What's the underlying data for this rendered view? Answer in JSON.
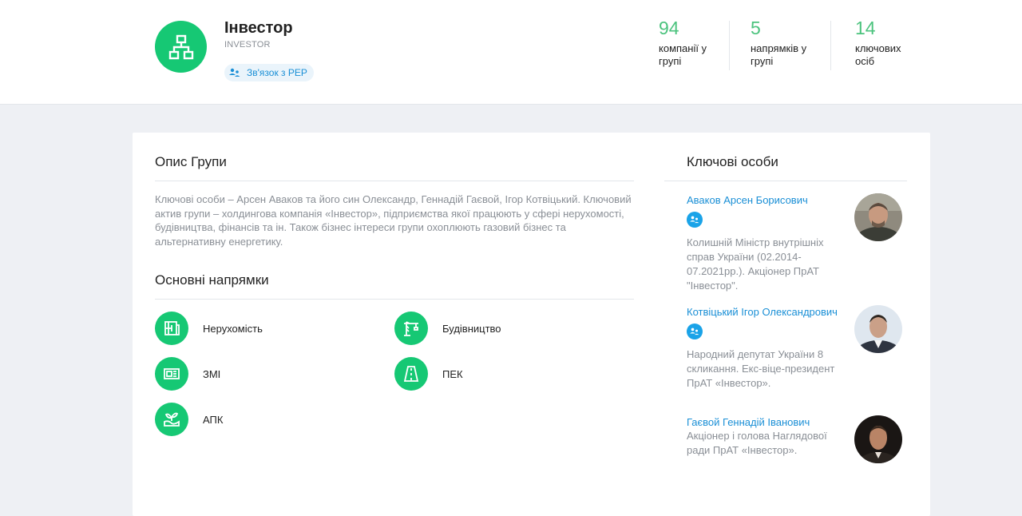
{
  "header": {
    "title": "Інвестор",
    "subtitle": "INVESTOR",
    "pep_link": "Зв'язок з PEP",
    "stats": [
      {
        "value": "94",
        "label": "компанії у групі"
      },
      {
        "value": "5",
        "label": "напрямків у групі"
      },
      {
        "value": "14",
        "label": "ключових осіб"
      }
    ]
  },
  "description": {
    "title": "Опис Групи",
    "text": "Ключові особи – Арсен Аваков та його син Олександр, Геннадій Гаєвой, Ігор Котвіцький. Ключовий актив групи – холдингова компанія «Інвестор», підприємства якої працюють у сфері нерухомості, будівництва, фінансів та ін. Також бізнес інтереси групи охоплюють газовий бізнес та альтернативну енергетику."
  },
  "directions": {
    "title": "Основні напрямки",
    "items": [
      {
        "label": "Нерухомість",
        "icon": "real-estate-icon"
      },
      {
        "label": "Будівництво",
        "icon": "construction-crane-icon"
      },
      {
        "label": "ЗМІ",
        "icon": "media-icon"
      },
      {
        "label": "ПЕК",
        "icon": "road-energy-icon"
      },
      {
        "label": "АПК",
        "icon": "agriculture-plant-icon"
      }
    ]
  },
  "key_persons": {
    "title": "Ключові особи",
    "items": [
      {
        "name": "Аваков Арсен Борисович",
        "pep": true,
        "description": "Колишній Міністр внутрішніх справ України (02.2014-07.2021рр.). Акціонер ПрАТ \"Інвестор\"."
      },
      {
        "name": "Котвіцький Ігор Олександрович",
        "pep": true,
        "description": "Народний депутат України 8 скликання. Екс-віце-президент ПрАТ «Інвестор»."
      },
      {
        "name": "Гаєвой Геннадій Іванович",
        "pep": false,
        "description": "Акціонер і голова Наглядової ради ПрАТ «Інвестор»."
      }
    ]
  },
  "colors": {
    "accent_green": "#16c874",
    "stat_green": "#4cc37e",
    "link_blue": "#1a8fd6",
    "pep_blue": "#1aa3e8"
  }
}
